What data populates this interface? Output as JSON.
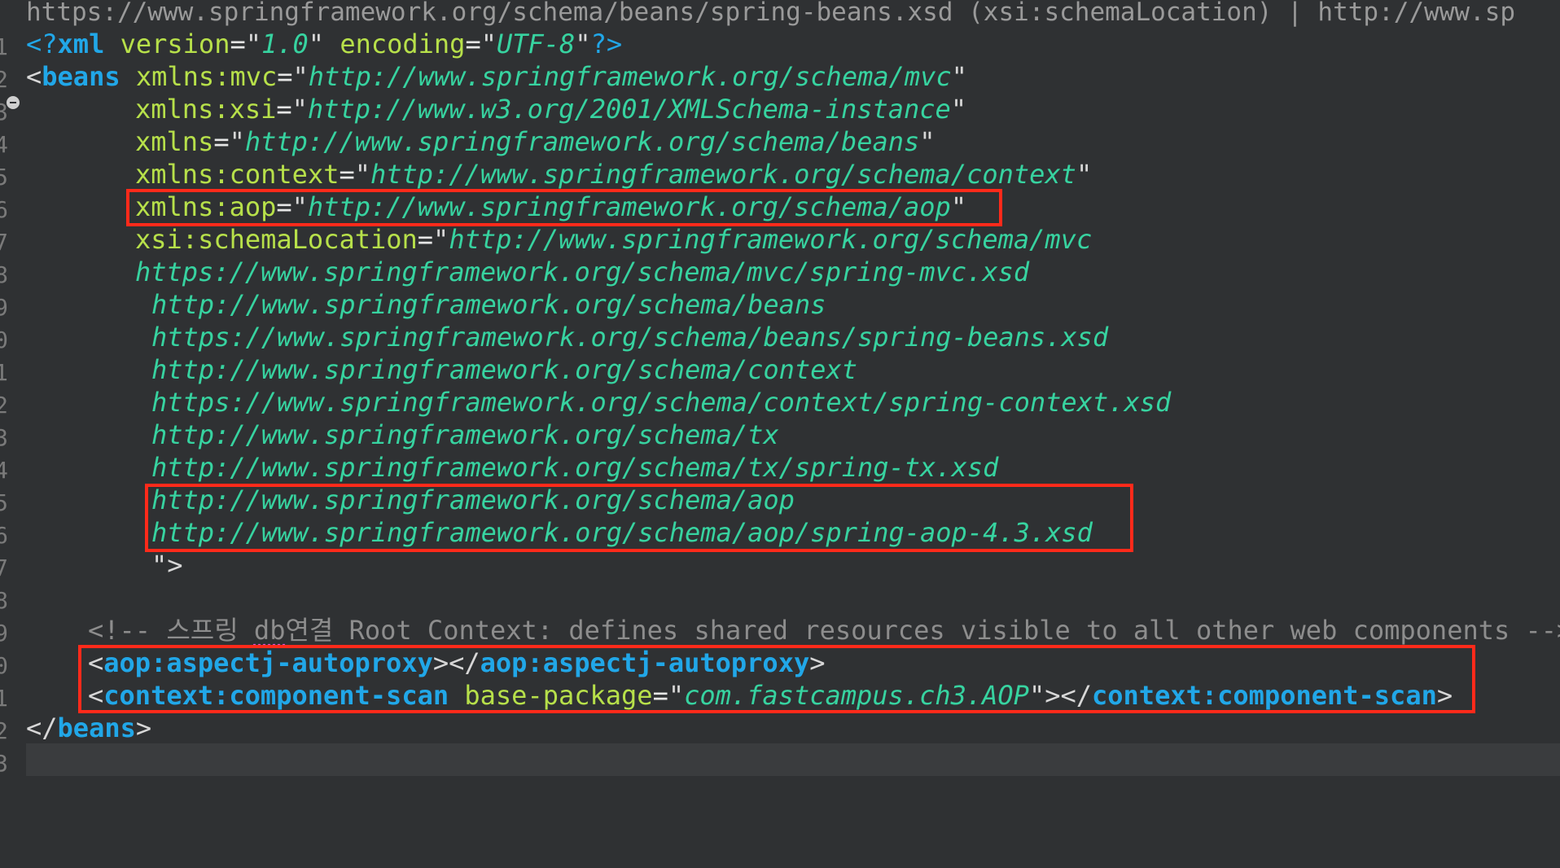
{
  "hover_text": "https://www.springframework.org/schema/beans/spring-beans.xsd (xsi:schemaLocation) | http://www.sp",
  "line_numbers": [
    "1",
    "2",
    "3",
    "4",
    "5",
    "6",
    "7",
    "8",
    "9",
    "0",
    "1",
    "2",
    "3",
    "4",
    "5",
    "6",
    "7",
    "8",
    "9",
    "0",
    "1",
    "2",
    "3"
  ],
  "code": {
    "decl": {
      "open": "<?",
      "tag": "xml",
      "attr1": " version",
      "val1": "1.0",
      "attr2": " encoding",
      "val2": "UTF-8",
      "close": "?>"
    },
    "beans_open": {
      "lt": "<",
      "tag": "beans",
      "attr": " xmlns:mvc",
      "val": "http://www.springframework.org/schema/mvc"
    },
    "ns_xsi": {
      "attr": "xmlns:xsi",
      "val": "http://www.w3.org/2001/XMLSchema-instance"
    },
    "ns_default": {
      "attr": "xmlns",
      "val": "http://www.springframework.org/schema/beans"
    },
    "ns_context": {
      "attr": "xmlns:context",
      "val": "http://www.springframework.org/schema/context"
    },
    "ns_aop": {
      "attr": "xmlns:aop",
      "val": "http://www.springframework.org/schema/aop"
    },
    "schema_location": {
      "attr": "xsi:schemaLocation",
      "val": "http://www.springframework.org/schema/mvc"
    },
    "schema_lines": [
      "https://www.springframework.org/schema/mvc/spring-mvc.xsd",
      "http://www.springframework.org/schema/beans",
      "https://www.springframework.org/schema/beans/spring-beans.xsd",
      "http://www.springframework.org/schema/context",
      "https://www.springframework.org/schema/context/spring-context.xsd",
      "http://www.springframework.org/schema/tx",
      "http://www.springframework.org/schema/tx/spring-tx.xsd",
      "http://www.springframework.org/schema/aop",
      "http://www.springframework.org/schema/aop/spring-aop-4.3.xsd"
    ],
    "schema_close": "\">",
    "comment": {
      "start": "<!-- 스프링 ",
      "misspelled": "db",
      "rest": "연결 Root Context: defines shared resources visible to all other web components -->"
    },
    "aspectj": {
      "lt": "<",
      "tag": "aop:aspectj-autoproxy",
      "mid": "></",
      "gt": ">"
    },
    "component_scan": {
      "lt": "<",
      "tag": "context:component-scan",
      "attr": " base-package",
      "val": "com.fastcampus.ch3.AOP",
      "mid": "></",
      "gt": ">"
    },
    "beans_close": {
      "lt": "</",
      "tag": "beans",
      "gt": ">"
    }
  },
  "colors": {
    "background": "#2f3133",
    "tag": "#21a7e8",
    "attribute": "#b7e04a",
    "value": "#37d3a0",
    "comment": "#8d8d8d",
    "highlight_box": "#ff2a1a"
  }
}
